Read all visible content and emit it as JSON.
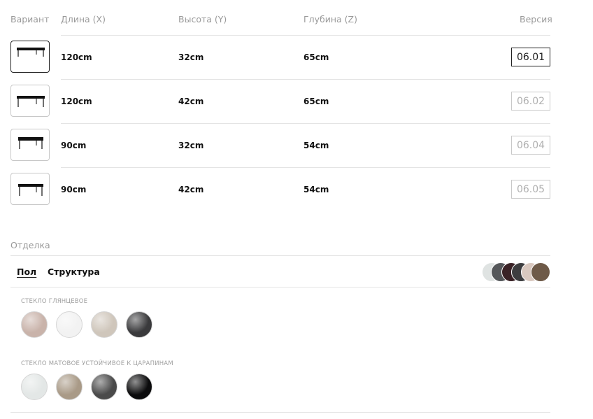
{
  "variants_table": {
    "headers": {
      "variant": "Вариант",
      "length": "Длина (X)",
      "height": "Высота (Y)",
      "depth": "Глубина (Z)",
      "version": "Версия"
    },
    "rows": [
      {
        "length": "120cm",
        "height": "32cm",
        "depth": "65cm",
        "version": "06.01",
        "selected": true
      },
      {
        "length": "120cm",
        "height": "42cm",
        "depth": "65cm",
        "version": "06.02",
        "selected": false
      },
      {
        "length": "90cm",
        "height": "32cm",
        "depth": "54cm",
        "version": "06.04",
        "selected": false
      },
      {
        "length": "90cm",
        "height": "42cm",
        "depth": "54cm",
        "version": "06.05",
        "selected": false
      }
    ]
  },
  "finish": {
    "label": "Отделка",
    "tabs": [
      {
        "label": "Пол",
        "active": true
      },
      {
        "label": "Структура",
        "active": false
      }
    ],
    "preview_colors": [
      "#dfe3e2",
      "#55575a",
      "#3a2226",
      "#3d3d3f",
      "#d9c8bf",
      "#6e5a48"
    ],
    "groups": [
      {
        "label": "СТЕКЛО ГЛЯНЦЕВОЕ",
        "swatches": [
          "#c9b3aa",
          "#f2f2f2",
          "#cfc6bb",
          "#3a3a3c"
        ]
      },
      {
        "label": "СТЕКЛО МАТОВОЕ УСТОЙЧИВОЕ К ЦАРАПИНАМ",
        "swatches": [
          "#e3e7e6",
          "#a99a87",
          "#4a4a4a",
          "#0b0b0c"
        ]
      }
    ]
  }
}
